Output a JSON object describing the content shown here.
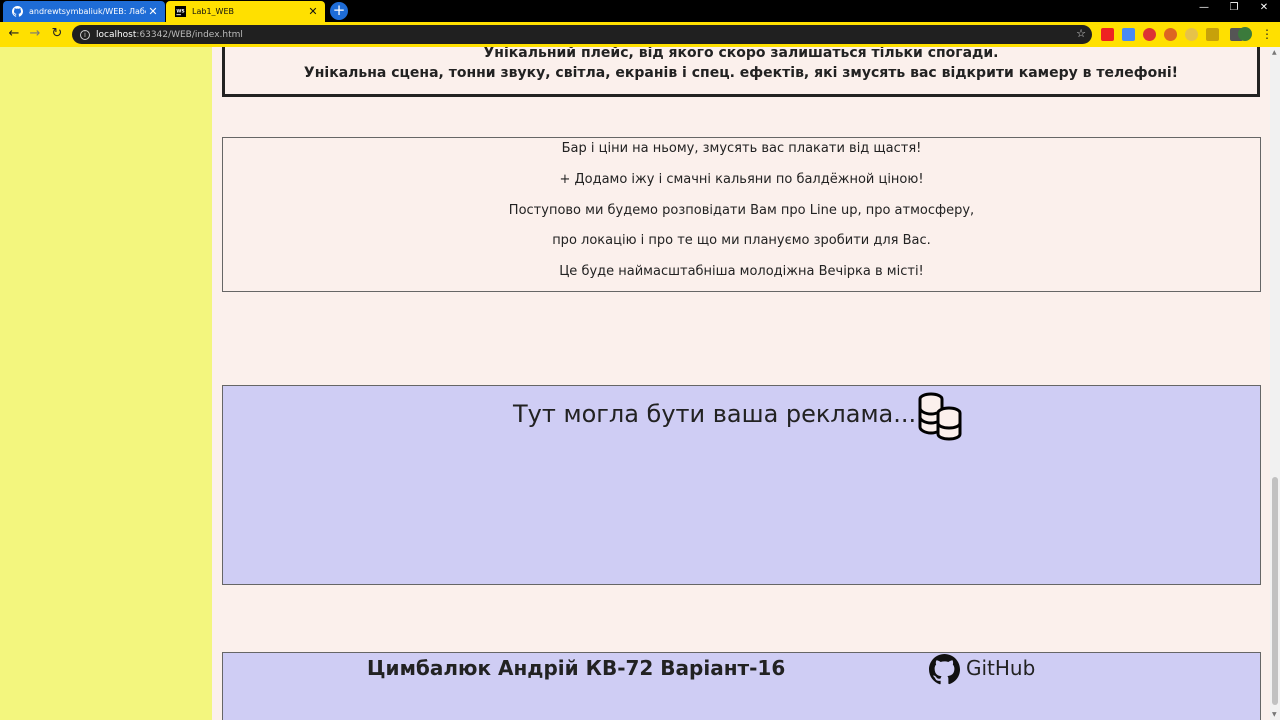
{
  "browser": {
    "tabs": [
      {
        "title": "andrewtsymbaliuk/WEB: Лабора",
        "close": "✕"
      },
      {
        "title": "Lab1_WEB",
        "close": "✕"
      }
    ],
    "new_tab": "+",
    "window_controls": {
      "minimize": "—",
      "restore": "❐",
      "close": "✕"
    },
    "address": {
      "host": "localhost",
      "path": ":63342/WEB/index.html"
    },
    "icons": [
      "github-favicon",
      "webstorm-favicon",
      "back-icon",
      "forward-icon",
      "reload-icon",
      "info-icon",
      "bookmark-star-icon"
    ]
  },
  "intro": {
    "line1": "Унікальний плейс, від якого скоро залишаться тільки спогади.",
    "line2": "Унікальна сцена, тонни звуку, світла, екранів і спец. ефектів, які змусять вас відкрити камеру в телефоні!"
  },
  "info": {
    "lines": [
      "Бар і ціни на ньому, змусять вас плакати від щастя!",
      "+ Додамо іжу і смачні кальяни по балдёжной ціною!",
      "Поступово ми будемо розповідати Вам про Line up, про атмосферу,",
      "про локацію і про те що ми плануємо зробити для Вас.",
      "Це буде наймасштабніша молодіжна Вечірка в місті!"
    ]
  },
  "ad": {
    "title": "Тут могла бути ваша реклама..."
  },
  "footer": {
    "author": "Цимбалюк Андрій КВ-72 Варіант-16",
    "github_label": "GitHub"
  },
  "colors": {
    "sidebar": "#f3f67e",
    "page_background": "#fbf0ec",
    "ad_background": "#cfcdf4",
    "chrome_yellow": "#ffe000",
    "tab_blue": "#1e6cd6"
  }
}
